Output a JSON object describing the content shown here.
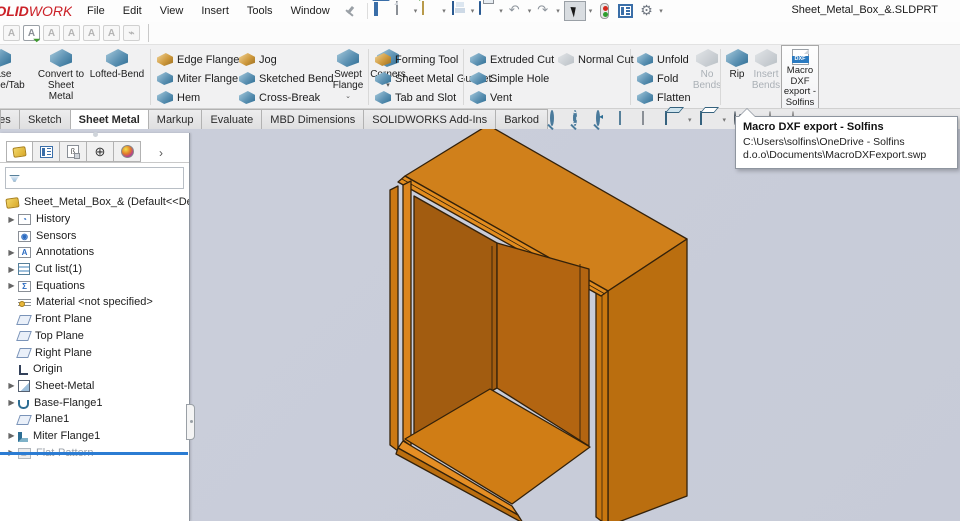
{
  "window": {
    "logo_bold": "SOLID",
    "logo_light": "WORKS",
    "doc_title": "Sheet_Metal_Box_&.SLDPRT"
  },
  "menubar": {
    "items": [
      "File",
      "Edit",
      "View",
      "Insert",
      "Tools",
      "Window"
    ]
  },
  "quickbar": {
    "icons": [
      "home",
      "new-document",
      "open",
      "save",
      "print",
      "undo",
      "redo",
      "select-cursor",
      "rebuild-traffic-light",
      "task-pane",
      "options-gear"
    ]
  },
  "ribbon": {
    "big": {
      "base_flange": "Base Flange/Tab",
      "convert": "Convert to Sheet Metal",
      "lofted": "Lofted-Bend",
      "swept": "Swept Flange",
      "corners": "Corners",
      "no_bends": "No Bends",
      "rip": "Rip",
      "insert_bends": "Insert Bends",
      "macro": "Macro DXF export - Solfins"
    },
    "cols": [
      [
        "Edge Flange",
        "Miter Flange",
        "Hem"
      ],
      [
        "Jog",
        "Sketched Bend",
        "Cross-Break"
      ],
      [
        "Forming Tool",
        "Sheet Metal Gusset",
        "Tab and Slot"
      ],
      [
        "Extruded Cut",
        "Simple Hole",
        "Vent"
      ],
      [
        "Normal Cut"
      ],
      [
        "Unfold",
        "Fold",
        "Flatten"
      ]
    ]
  },
  "tabs": {
    "items": [
      "Features",
      "Sketch",
      "Sheet Metal",
      "Markup",
      "Evaluate",
      "MBD Dimensions",
      "SOLIDWORKS Add-Ins",
      "Barkod"
    ],
    "active": "Sheet Metal"
  },
  "tree": {
    "root": "Sheet_Metal_Box_&  (Default<<Default>",
    "items": [
      {
        "label": "History"
      },
      {
        "label": "Sensors"
      },
      {
        "label": "Annotations"
      },
      {
        "label": "Cut list(1)"
      },
      {
        "label": "Equations"
      },
      {
        "label": "Material <not specified>"
      },
      {
        "label": "Front Plane"
      },
      {
        "label": "Top Plane"
      },
      {
        "label": "Right Plane"
      },
      {
        "label": "Origin"
      },
      {
        "label": "Sheet-Metal"
      },
      {
        "label": "Base-Flange1"
      },
      {
        "label": "Plane1"
      },
      {
        "label": "Miter Flange1"
      },
      {
        "label": "Flat-Pattern"
      }
    ]
  },
  "tooltip": {
    "title": "Macro DXF export - Solfins",
    "path_line1": "C:\\Users\\solfins\\OneDrive - Solfins",
    "path_line2": "d.o.o\\Documents\\MacroDXFexport.swp"
  },
  "colors": {
    "accent_red": "#cb2128",
    "viewport_bg": "#c8ccd8",
    "model_top": "#d0801b",
    "model_right": "#ba6e0f",
    "model_interior": "#a25c10",
    "model_floor": "#d07d15",
    "rollback_blue": "#2b7cd3"
  }
}
